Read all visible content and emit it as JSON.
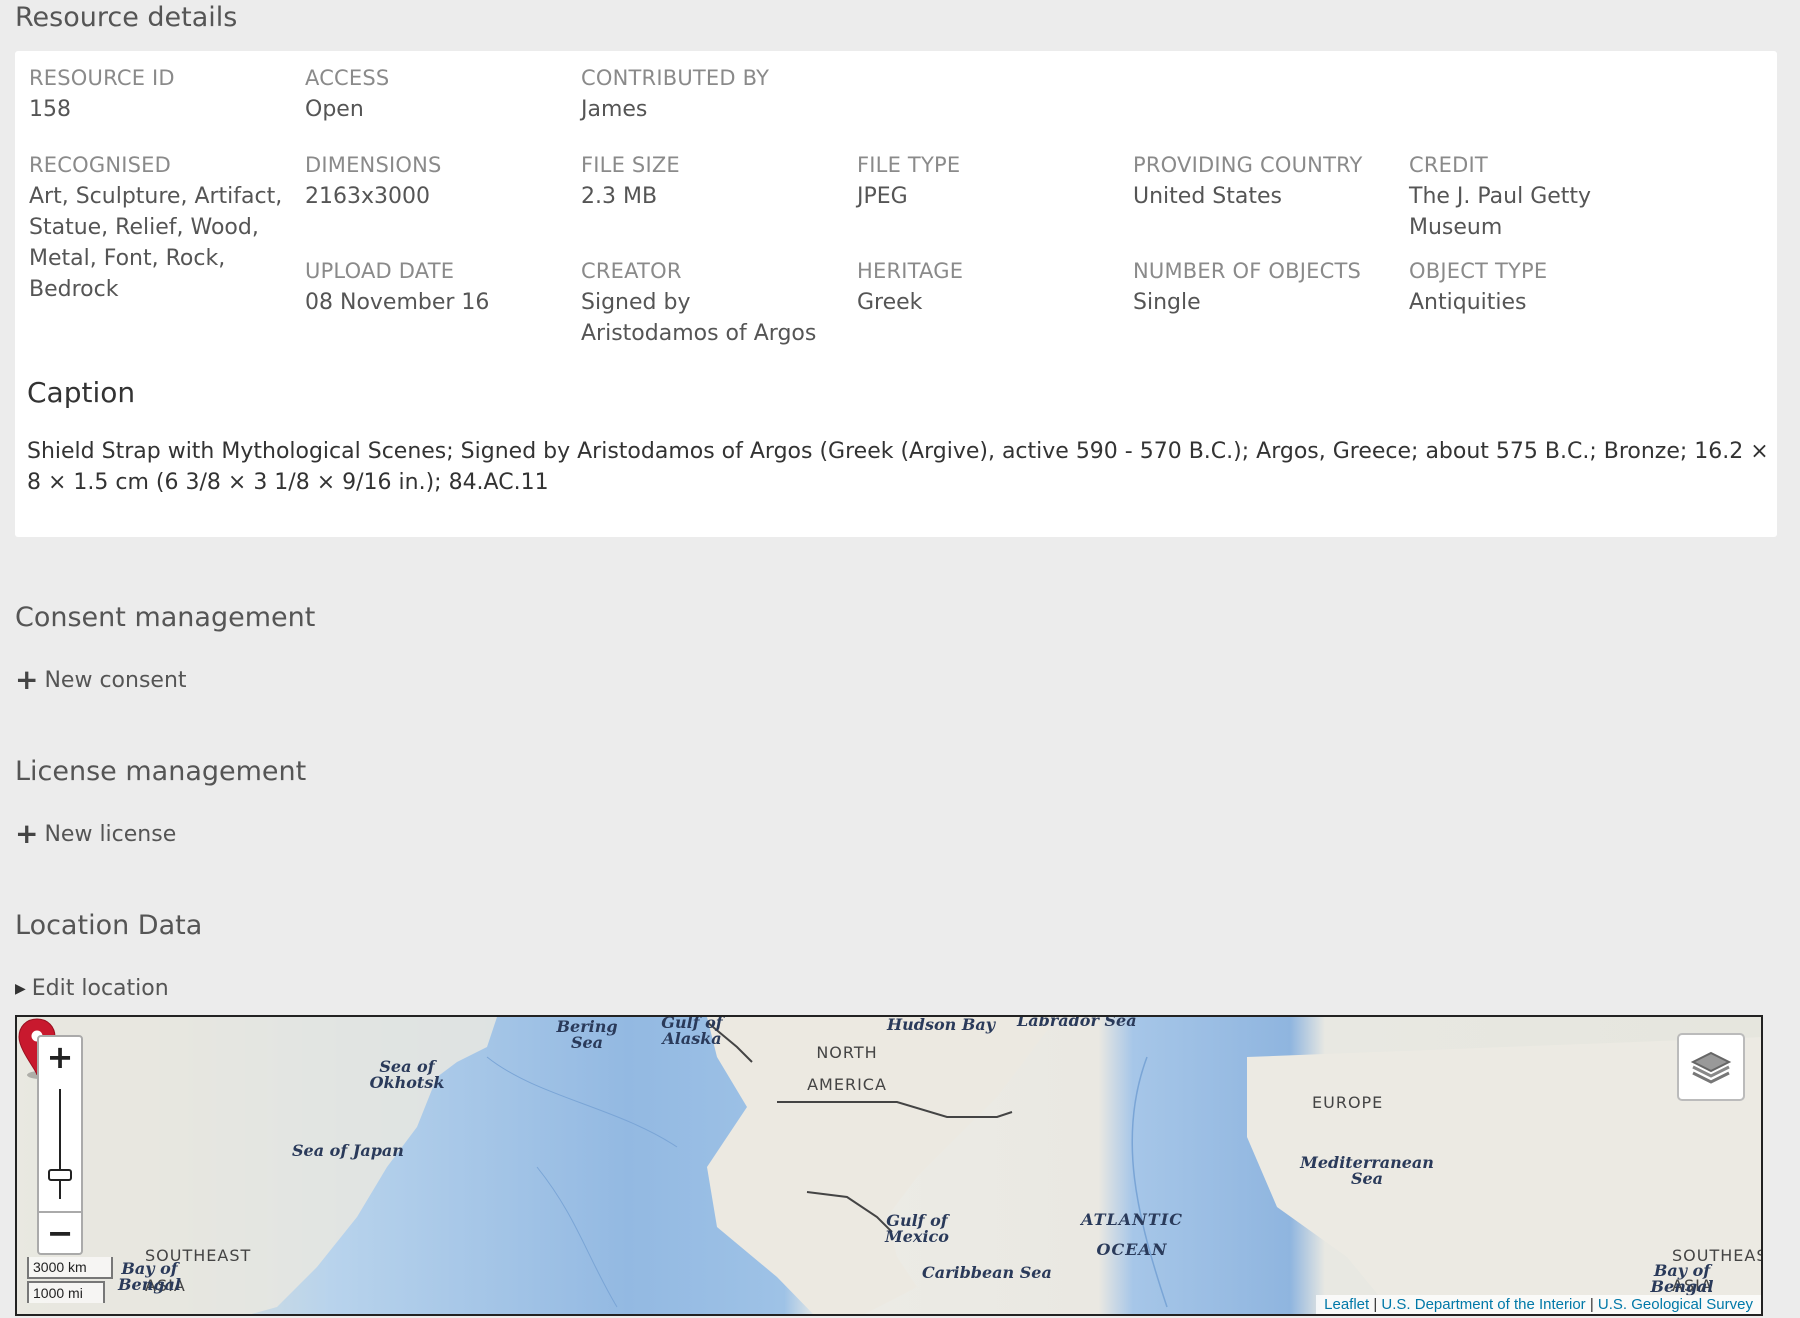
{
  "resource_details": {
    "title": "Resource details",
    "fields": {
      "resource_id": {
        "label": "RESOURCE ID",
        "value": "158"
      },
      "access": {
        "label": "ACCESS",
        "value": "Open"
      },
      "contributed_by": {
        "label": "CONTRIBUTED BY",
        "value": "James"
      },
      "recognised": {
        "label": "RECOGNISED",
        "value": "Art, Sculpture, Artifact, Statue, Relief, Wood, Metal, Font, Rock, Bedrock"
      },
      "dimensions": {
        "label": "DIMENSIONS",
        "value": "2163x3000"
      },
      "file_size": {
        "label": "FILE SIZE",
        "value": "2.3 MB"
      },
      "file_type": {
        "label": "FILE TYPE",
        "value": "JPEG"
      },
      "providing_country": {
        "label": "PROVIDING COUNTRY",
        "value": "United States"
      },
      "credit": {
        "label": "CREDIT",
        "value": "The J. Paul Getty Museum"
      },
      "upload_date": {
        "label": "UPLOAD DATE",
        "value": "08 November 16"
      },
      "creator": {
        "label": "CREATOR",
        "value": "Signed by Aristodamos of Argos"
      },
      "heritage": {
        "label": "HERITAGE",
        "value": "Greek"
      },
      "number_of_objects": {
        "label": "NUMBER OF OBJECTS",
        "value": "Single"
      },
      "object_type": {
        "label": "OBJECT TYPE",
        "value": "Antiquities"
      }
    },
    "caption": {
      "title": "Caption",
      "text": "Shield Strap with Mythological Scenes; Signed by Aristodamos of Argos (Greek (Argive), active 590 - 570 B.C.); Argos, Greece; about 575 B.C.; Bronze; 16.2 × 8 × 1.5 cm (6 3/8 × 3 1/8 × 9/16 in.); 84.AC.11"
    }
  },
  "consent": {
    "title": "Consent management",
    "action": "New consent"
  },
  "license": {
    "title": "License management",
    "action": "New license"
  },
  "location": {
    "title": "Location Data",
    "action": "Edit location",
    "map": {
      "zoom_in": "+",
      "zoom_out": "−",
      "scale_km": "3000 km",
      "scale_mi": "1000 mi",
      "labels": {
        "bering_sea": "Bering Sea",
        "gulf_of_alaska": "Gulf of Alaska",
        "hudson_bay": "Hudson Bay",
        "labrador_sea": "Labrador Sea",
        "north_america": "NORTH AMERICA",
        "sea_of_okhotsk": "Sea of Okhotsk",
        "sea_of_japan": "Sea of Japan",
        "europe": "EUROPE",
        "mediterranean_sea": "Mediterranean Sea",
        "gulf_of_mexico": "Gulf of Mexico",
        "atlantic_ocean": "ATLANTIC OCEAN",
        "caribbean_sea": "Caribbean Sea",
        "southeast_asia_left": "SOUTHEAST ASIA",
        "bay_of_bengal_left": "Bay of Bengal",
        "southeast_asia_right": "SOUTHEAS ASIA",
        "bay_of_bengal_right": "Bay of Bengal"
      },
      "attribution": {
        "leaflet": "Leaflet",
        "sep": " | ",
        "doi": "U.S. Department of the Interior",
        "usgs": "U.S. Geological Survey"
      }
    }
  },
  "colors": {
    "marker": "#c8192e",
    "link": "#0078a8",
    "background": "#ececec"
  }
}
